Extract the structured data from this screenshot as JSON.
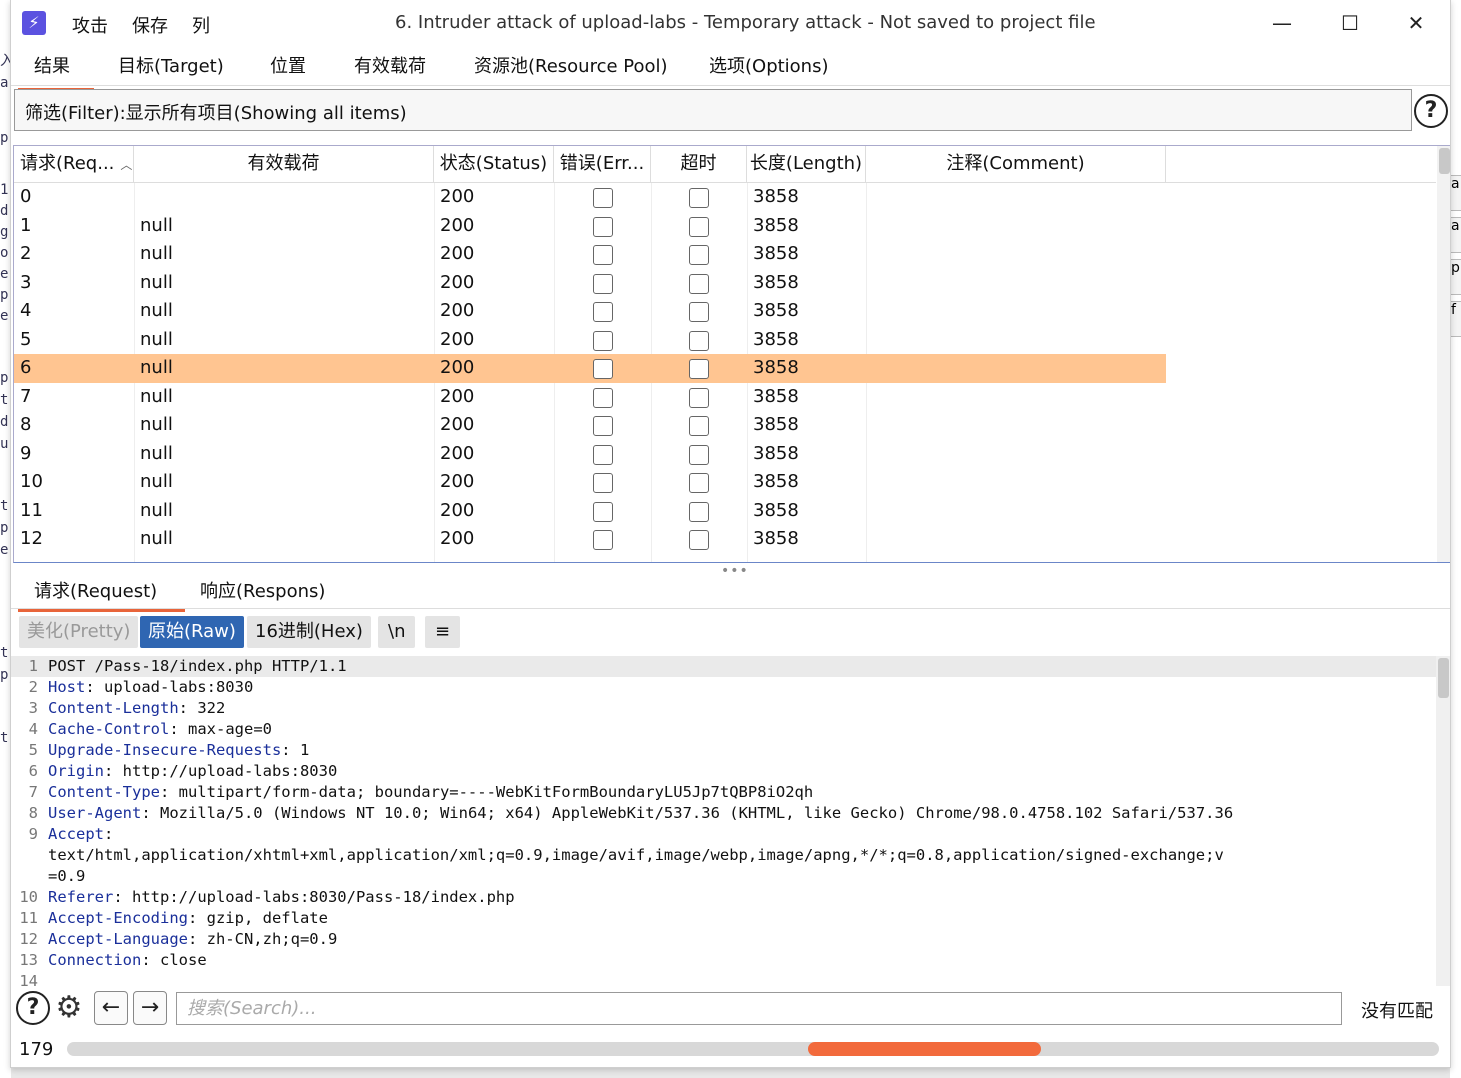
{
  "app": {
    "menu": [
      "攻击",
      "保存",
      "列"
    ],
    "title": "6. Intruder attack of upload-labs - Temporary attack - Not saved to project file",
    "window_controls": {
      "minimize": "—",
      "maximize": "☐",
      "close": "✕"
    }
  },
  "main_tabs": [
    "结果",
    "目标(Target)",
    "位置",
    "有效载荷",
    "资源池(Resource Pool)",
    "选项(Options)"
  ],
  "filter": {
    "label": "筛选(Filter):显示所有项目(Showing all items)"
  },
  "table": {
    "headers": [
      "请求(Req...",
      "有效载荷",
      "状态(Status)",
      "错误(Err...",
      "超时",
      "长度(Length)",
      "注释(Comment)"
    ],
    "selected_row": 6,
    "rows": [
      {
        "req": "0",
        "payload": "",
        "status": "200",
        "length": "3858"
      },
      {
        "req": "1",
        "payload": "null",
        "status": "200",
        "length": "3858"
      },
      {
        "req": "2",
        "payload": "null",
        "status": "200",
        "length": "3858"
      },
      {
        "req": "3",
        "payload": "null",
        "status": "200",
        "length": "3858"
      },
      {
        "req": "4",
        "payload": "null",
        "status": "200",
        "length": "3858"
      },
      {
        "req": "5",
        "payload": "null",
        "status": "200",
        "length": "3858"
      },
      {
        "req": "6",
        "payload": "null",
        "status": "200",
        "length": "3858"
      },
      {
        "req": "7",
        "payload": "null",
        "status": "200",
        "length": "3858"
      },
      {
        "req": "8",
        "payload": "null",
        "status": "200",
        "length": "3858"
      },
      {
        "req": "9",
        "payload": "null",
        "status": "200",
        "length": "3858"
      },
      {
        "req": "10",
        "payload": "null",
        "status": "200",
        "length": "3858"
      },
      {
        "req": "11",
        "payload": "null",
        "status": "200",
        "length": "3858"
      },
      {
        "req": "12",
        "payload": "null",
        "status": "200",
        "length": "3858"
      }
    ]
  },
  "sub_tabs": [
    "请求(Request)",
    "响应(Respons)"
  ],
  "view_modes": [
    "美化(Pretty)",
    "原始(Raw)",
    "16进制(Hex)",
    "\\n",
    "≡"
  ],
  "request_lines": [
    {
      "n": "1",
      "key": "",
      "val": "POST /Pass-18/index.php HTTP/1.1"
    },
    {
      "n": "2",
      "key": "Host",
      "val": ": upload-labs:8030"
    },
    {
      "n": "3",
      "key": "Content-Length",
      "val": ": 322"
    },
    {
      "n": "4",
      "key": "Cache-Control",
      "val": ": max-age=0"
    },
    {
      "n": "5",
      "key": "Upgrade-Insecure-Requests",
      "val": ": 1"
    },
    {
      "n": "6",
      "key": "Origin",
      "val": ": http://upload-labs:8030"
    },
    {
      "n": "7",
      "key": "Content-Type",
      "val": ": multipart/form-data; boundary=----WebKitFormBoundaryLU5Jp7tQBP8iO2qh"
    },
    {
      "n": "8",
      "key": "User-Agent",
      "val": ": Mozilla/5.0 (Windows NT 10.0; Win64; x64) AppleWebKit/537.36 (KHTML, like Gecko) Chrome/98.0.4758.102 Safari/537.36"
    },
    {
      "n": "9",
      "key": "Accept",
      "val": ":"
    },
    {
      "n": "",
      "key": "",
      "val": "text/html,application/xhtml+xml,application/xml;q=0.9,image/avif,image/webp,image/apng,*/*;q=0.8,application/signed-exchange;v"
    },
    {
      "n": "",
      "key": "",
      "val": "=0.9"
    },
    {
      "n": "10",
      "key": "Referer",
      "val": ": http://upload-labs:8030/Pass-18/index.php"
    },
    {
      "n": "11",
      "key": "Accept-Encoding",
      "val": ": gzip, deflate"
    },
    {
      "n": "12",
      "key": "Accept-Language",
      "val": ": zh-CN,zh;q=0.9"
    },
    {
      "n": "13",
      "key": "Connection",
      "val": ": close"
    },
    {
      "n": "14",
      "key": "",
      "val": ""
    }
  ],
  "search": {
    "placeholder": "搜索(Search)...",
    "status": "没有匹配"
  },
  "status": {
    "count": "179",
    "progress_start": 0.54,
    "progress_end": 0.71
  },
  "colors": {
    "accent": "#e8643a",
    "selected_row": "#ffc591",
    "raw_active": "#2f66b2",
    "header_key": "#1a2f9a",
    "progress": "#f26a3c"
  }
}
